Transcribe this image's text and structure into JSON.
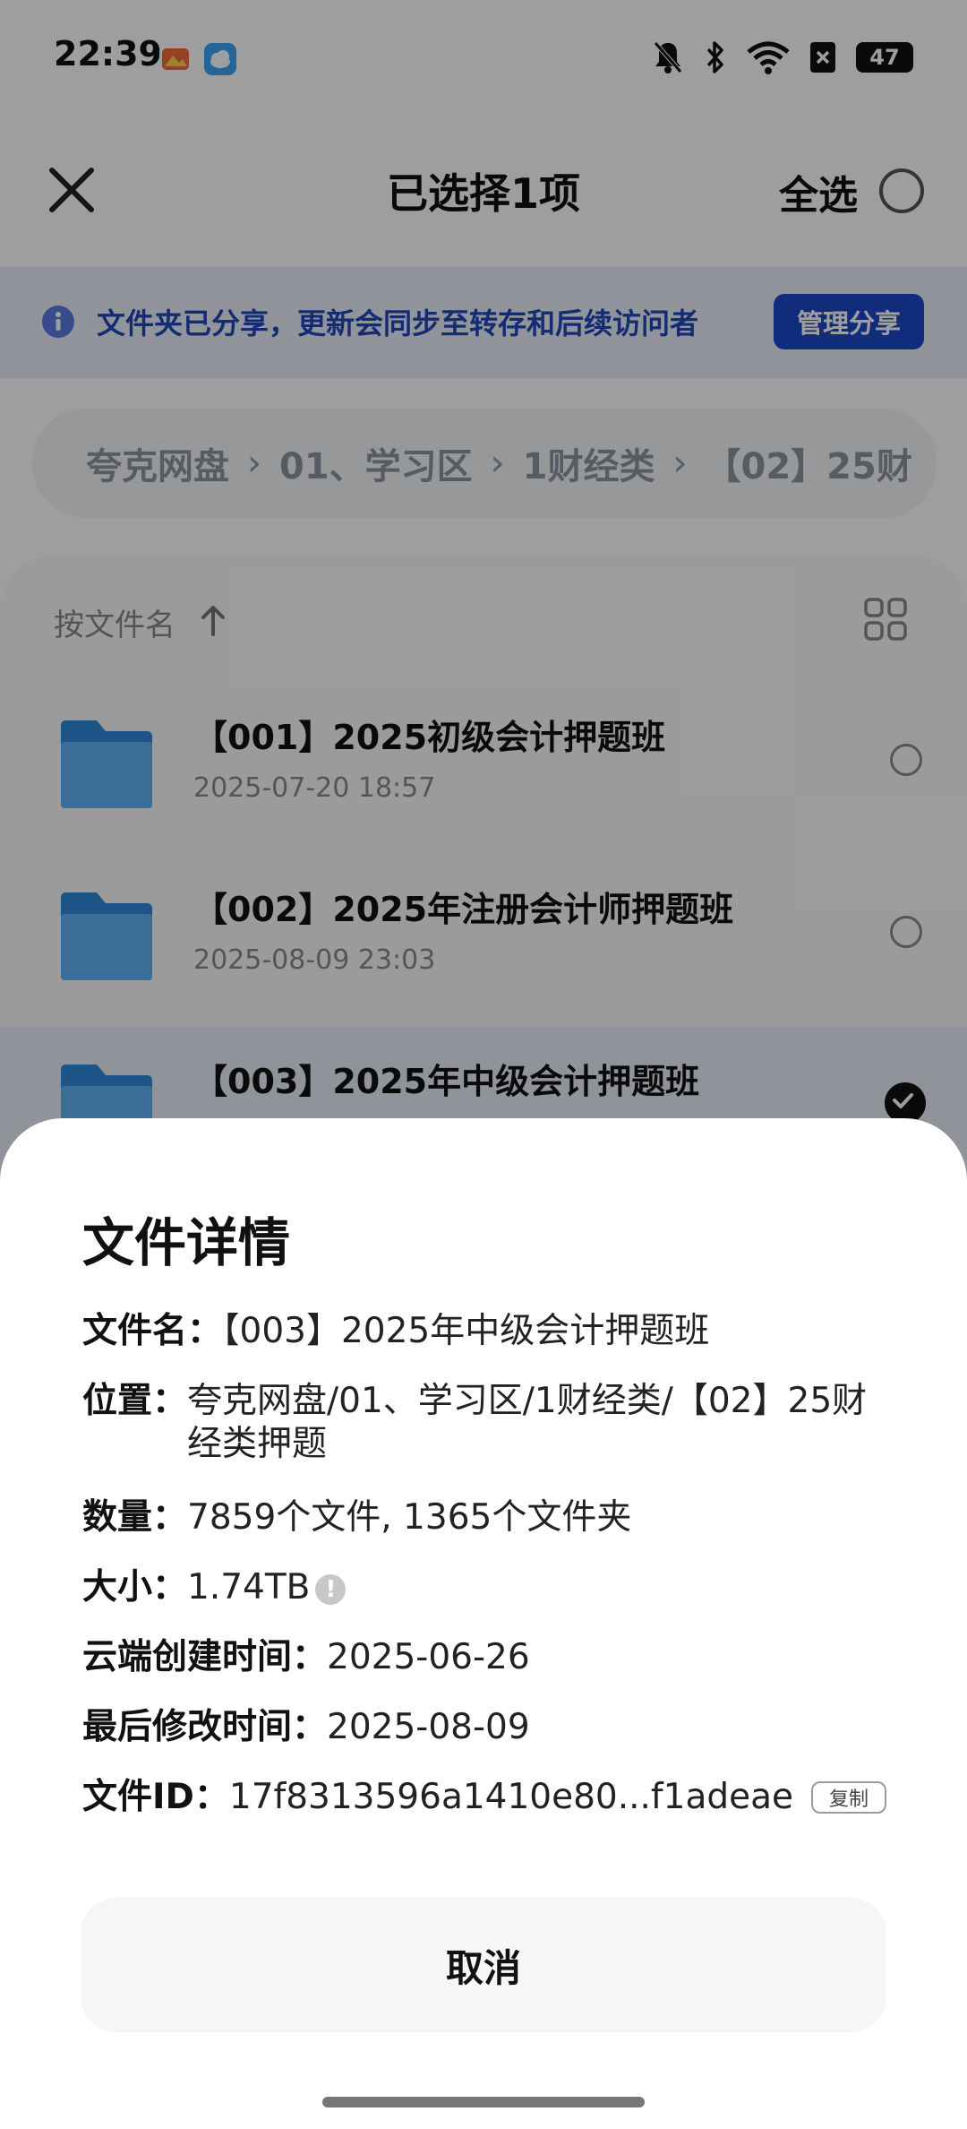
{
  "status_bar": {
    "time": "22:39",
    "battery": "47",
    "icons": [
      "gallery-app-icon",
      "weather-app-icon",
      "mute-icon",
      "bluetooth-icon",
      "wifi-icon",
      "sim-disabled-icon",
      "battery-icon"
    ]
  },
  "header": {
    "title": "已选择1项",
    "select_all_label": "全选"
  },
  "share_banner": {
    "text": "文件夹已分享，更新会同步至转存和后续访问者",
    "button_label": "管理分享"
  },
  "breadcrumb": {
    "items": [
      "夸克网盘",
      "01、学习区",
      "1财经类",
      "【02】25财"
    ],
    "separator": "›"
  },
  "list": {
    "sort_label": "按文件名",
    "files": [
      {
        "name": "【001】2025初级会计押题班",
        "date": "2025-07-20 18:57",
        "selected": false
      },
      {
        "name": "【002】2025年注册会计师押题班",
        "date": "2025-08-09 23:03",
        "selected": false
      },
      {
        "name": "【003】2025年中级会计押题班",
        "date": "",
        "selected": true
      }
    ]
  },
  "details_sheet": {
    "title": "文件详情",
    "filename_label": "文件名：",
    "filename_value": "【003】2025年中级会计押题班",
    "location_label": "位置：",
    "location_value": "夸克网盘/01、学习区/1财经类/【02】25财经类押题",
    "count_label": "数量：",
    "count_value": "7859个文件, 1365个文件夹",
    "size_label": "大小：",
    "size_value": "1.74TB",
    "created_label": "云端创建时间：",
    "created_value": "2025-06-26",
    "modified_label": "最后修改时间：",
    "modified_value": "2025-08-09",
    "file_id_label": "文件ID：",
    "file_id_value": "17f8313596a1410e80...f1adeae",
    "copy_label": "复制",
    "cancel_label": "取消"
  },
  "colors": {
    "accent_blue": "#1d48c9",
    "banner_text": "#1f47b8",
    "folder_blue": "#2f8ad8"
  }
}
